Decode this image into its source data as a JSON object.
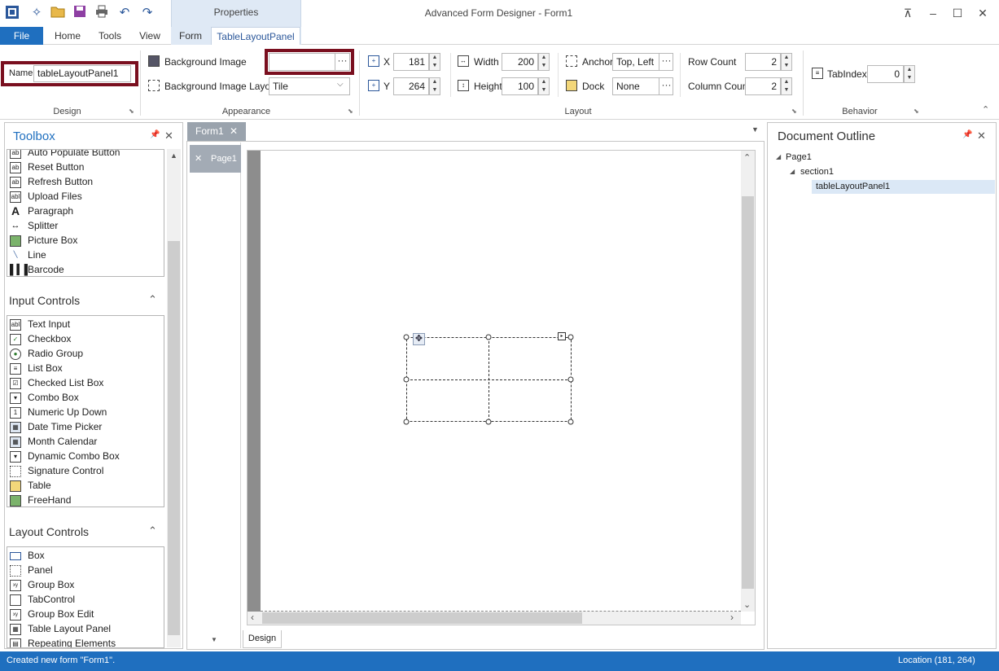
{
  "window": {
    "title": "Advanced Form Designer - Form1",
    "context_label": "Properties"
  },
  "ribbon_tabs": [
    "File",
    "Home",
    "Tools",
    "View",
    "Form",
    "TableLayoutPanel"
  ],
  "ribbon": {
    "design": {
      "group_label": "Design",
      "name_label": "Name",
      "name_value": "tableLayoutPanel1"
    },
    "appearance": {
      "group_label": "Appearance",
      "bg_image_label": "Background Image",
      "bg_image_value": "",
      "bg_layout_label": "Background Image Layout",
      "bg_layout_value": "Tile"
    },
    "layout": {
      "group_label": "Layout",
      "x_label": "X",
      "x_value": "181",
      "y_label": "Y",
      "y_value": "264",
      "width_label": "Width",
      "width_value": "200",
      "height_label": "Height",
      "height_value": "100",
      "anchor_label": "Anchor",
      "anchor_value": "Top, Left",
      "dock_label": "Dock",
      "dock_value": "None",
      "row_count_label": "Row Count",
      "row_count_value": "2",
      "column_count_label": "Column Count",
      "column_count_value": "2"
    },
    "behavior": {
      "group_label": "Behavior",
      "tabindex_label": "TabIndex",
      "tabindex_value": "0"
    }
  },
  "toolbox": {
    "title": "Toolbox",
    "top_items": [
      "Auto Populate Button",
      "Reset Button",
      "Refresh Button",
      "Upload Files",
      "Paragraph",
      "Splitter",
      "Picture Box",
      "Line",
      "Barcode"
    ],
    "input_title": "Input Controls",
    "input_items": [
      "Text Input",
      "Checkbox",
      "Radio Group",
      "List Box",
      "Checked List Box",
      "Combo Box",
      "Numeric Up Down",
      "Date Time Picker",
      "Month Calendar",
      "Dynamic Combo Box",
      "Signature Control",
      "Table",
      "FreeHand"
    ],
    "layout_title": "Layout Controls",
    "layout_items": [
      "Box",
      "Panel",
      "Group Box",
      "TabControl",
      "Group Box Edit",
      "Table Layout Panel",
      "Repeating Elements"
    ]
  },
  "document": {
    "tab_label": "Form1",
    "page_label": "Page1",
    "bottom_tab": "Design"
  },
  "outline": {
    "title": "Document Outline",
    "nodes": [
      "Page1",
      "section1",
      "tableLayoutPanel1"
    ]
  },
  "status": {
    "left": "Created new form \"Form1\".",
    "right": "Location (181, 264)"
  },
  "colors": {
    "accent": "#1f6fbf",
    "highlight_border": "#7a0f1f",
    "selection": "#dbe8f6"
  }
}
